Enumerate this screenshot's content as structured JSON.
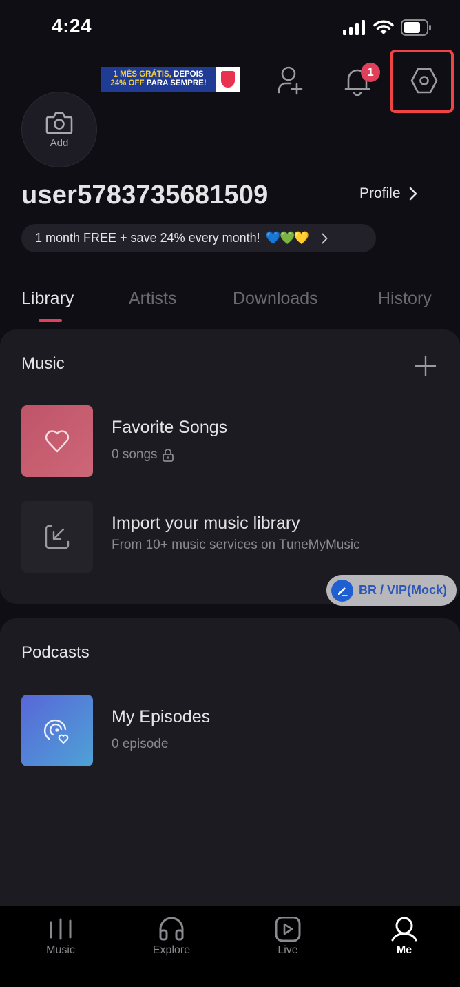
{
  "status_bar": {
    "time": "4:24"
  },
  "header": {
    "promo_banner": {
      "line1_yellow": "1 MÊS GRÁTIS,",
      "line1_white": " DEPOIS",
      "line2_yellow": "24% OFF",
      "line2_white": " PARA SEMPRE!"
    },
    "notification_count": "1",
    "icons": [
      "add-friend-icon",
      "bell-icon",
      "settings-icon"
    ]
  },
  "profile": {
    "avatar_label": "Add",
    "username": "user5783735681509",
    "profile_link": "Profile",
    "promo_pill": "1 month FREE + save 24% every month!",
    "promo_hearts": "💙💚💛"
  },
  "tabs": [
    {
      "label": "Library",
      "active": true
    },
    {
      "label": "Artists",
      "active": false
    },
    {
      "label": "Downloads",
      "active": false
    },
    {
      "label": "History",
      "active": false
    }
  ],
  "music_section": {
    "title": "Music",
    "items": [
      {
        "title": "Favorite Songs",
        "subtitle": "0 songs"
      },
      {
        "title": "Import your music library",
        "subtitle": "From 10+ music services on TuneMyMusic"
      }
    ]
  },
  "vip_pill": {
    "label": "BR / VIP(Mock)"
  },
  "podcasts_section": {
    "title": "Podcasts",
    "items": [
      {
        "title": "My Episodes",
        "subtitle": "0 episode"
      }
    ]
  },
  "bottom_nav": [
    {
      "label": "Music",
      "active": false
    },
    {
      "label": "Explore",
      "active": false
    },
    {
      "label": "Live",
      "active": false
    },
    {
      "label": "Me",
      "active": true
    }
  ],
  "colors": {
    "accent": "#e0405a",
    "highlight_box": "#ef4444",
    "background": "#0f0e15",
    "card": "#1c1b21"
  }
}
